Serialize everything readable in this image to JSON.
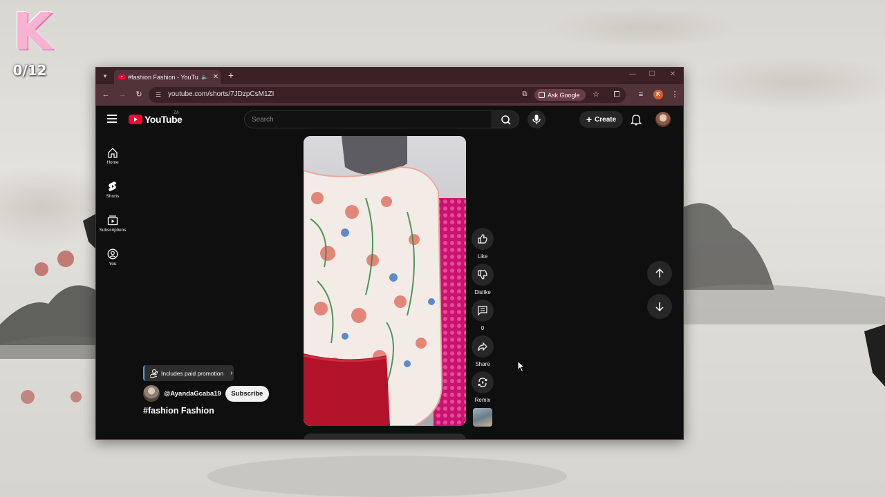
{
  "desktop": {
    "overlay_counter": "0/12"
  },
  "browser": {
    "tab": {
      "title": "#fashion Fashion - YouTube",
      "favicon": "youtube-favicon",
      "audio_icon": "speaker-icon"
    },
    "new_tab_label": "+",
    "url": "youtube.com/shorts/7JDzpCsM1ZI",
    "ask_google_label": "Ask Google",
    "profile_initial": "K"
  },
  "youtube": {
    "logo_text": "YouTube",
    "country_code": "ZA",
    "search_placeholder": "Search",
    "create_label": "Create",
    "sidebar": [
      {
        "label": "Home",
        "icon": "home-icon"
      },
      {
        "label": "Shorts",
        "icon": "shorts-icon"
      },
      {
        "label": "Subscriptions",
        "icon": "subscriptions-icon"
      },
      {
        "label": "You",
        "icon": "you-icon"
      }
    ],
    "actions": {
      "like": "Like",
      "dislike": "Dislike",
      "comments": "0",
      "share": "Share",
      "remix": "Remix"
    },
    "short": {
      "paid_promotion": "Includes paid promotion",
      "channel": "@AyandaGcaba19",
      "subscribe": "Subscribe",
      "title": "#fashion Fashion"
    }
  },
  "colors": {
    "youtube_red": "#ff0033",
    "browser_frame": "#52333a",
    "page_bg": "#0f0f0f"
  }
}
